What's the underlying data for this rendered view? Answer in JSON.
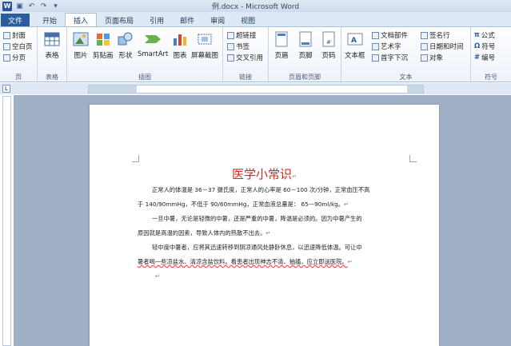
{
  "title_bar": {
    "title": "例.docx - Microsoft Word"
  },
  "tabs": [
    "文件",
    "开始",
    "插入",
    "页面布局",
    "引用",
    "邮件",
    "审阅",
    "视图"
  ],
  "ribbon": {
    "pages": {
      "label": "页",
      "items": [
        "封面",
        "空白页",
        "分页"
      ]
    },
    "tables": {
      "label": "表格",
      "button": "表格"
    },
    "illustrations": {
      "label": "插图",
      "buttons": [
        "图片",
        "剪贴画",
        "形状",
        "SmartArt",
        "图表",
        "屏幕截图"
      ]
    },
    "links": {
      "label": "链接",
      "items": [
        "超链接",
        "书签",
        "交叉引用"
      ]
    },
    "header_footer": {
      "label": "页眉和页脚",
      "buttons": [
        "页眉",
        "页脚",
        "页码"
      ]
    },
    "text": {
      "label": "文本",
      "big": "文本框",
      "col1": [
        "文档部件",
        "艺术字",
        "首字下沉"
      ],
      "col2": [
        "签名行",
        "日期和时间",
        "对象"
      ]
    },
    "symbols": {
      "label": "符号",
      "items": [
        "公式",
        "符号",
        "编号"
      ]
    }
  },
  "document": {
    "title": "医学小常识",
    "lines": [
      "正常人的体温是 36－37 摄氏度，正常人的心率是 60－100 次/分钟，正常血压不高",
      "于 140/90mmHg，不低于 90/60mmHg，正常血液总量是： 65—90ml/kg。",
      "一旦中暑，无论是轻微的中暑，还是严重的中暑，降温是必须的。因为中暑产生的",
      "原因就是高温的因素，导致人体内的热散不出去。",
      "轻中度中暑者，应将其迅速转移到阴凉通风处静卧休息，以迅速降低体温。可让中",
      "暑者喝一些凉盐水、清凉含盐饮料。看患者出现神志不清、抽搐，应立即送医院。"
    ],
    "paragraph_mark": "↵"
  },
  "colors": {
    "accent": "#2a5c9e",
    "doc_title": "#e3241b"
  }
}
